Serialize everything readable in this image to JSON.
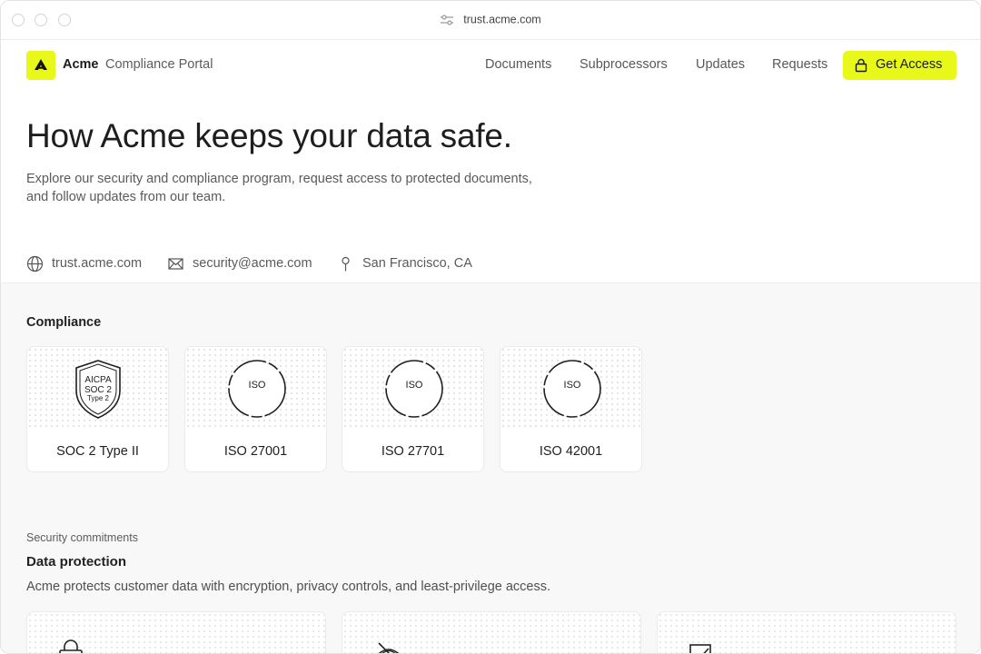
{
  "browser": {
    "url": "trust.acme.com"
  },
  "nav": {
    "brand": "Acme",
    "brand_sub": "Compliance Portal",
    "links": [
      "Documents",
      "Subprocessors",
      "Updates",
      "Requests"
    ],
    "cta_label": "Get Access",
    "accent": "#e8f91a"
  },
  "hero": {
    "title": "How Acme keeps your data safe.",
    "desc_line1": "Explore our security and compliance program, request access to protected documents,",
    "desc_line2": "and follow updates from our team."
  },
  "info": {
    "website": "trust.acme.com",
    "email": "security@acme.com",
    "location": "San Francisco, CA"
  },
  "compliance": {
    "title": "Compliance",
    "badges": [
      {
        "label": "SOC 2 Type II",
        "seal": [
          "AICPA",
          "SOC 2",
          "Type 2"
        ]
      },
      {
        "label": "ISO 27001",
        "seal": "ISO"
      },
      {
        "label": "ISO 27701",
        "seal": "ISO"
      },
      {
        "label": "ISO 42001",
        "seal": "ISO"
      }
    ]
  },
  "commitments": {
    "kicker": "Security commitments",
    "title": "Data protection",
    "desc": "Acme protects customer data with encryption, privacy controls, and least-privilege access.",
    "cards": [
      {
        "icon": "lock-icon"
      },
      {
        "icon": "eye-off-icon"
      },
      {
        "icon": "checkbox-icon"
      }
    ]
  }
}
